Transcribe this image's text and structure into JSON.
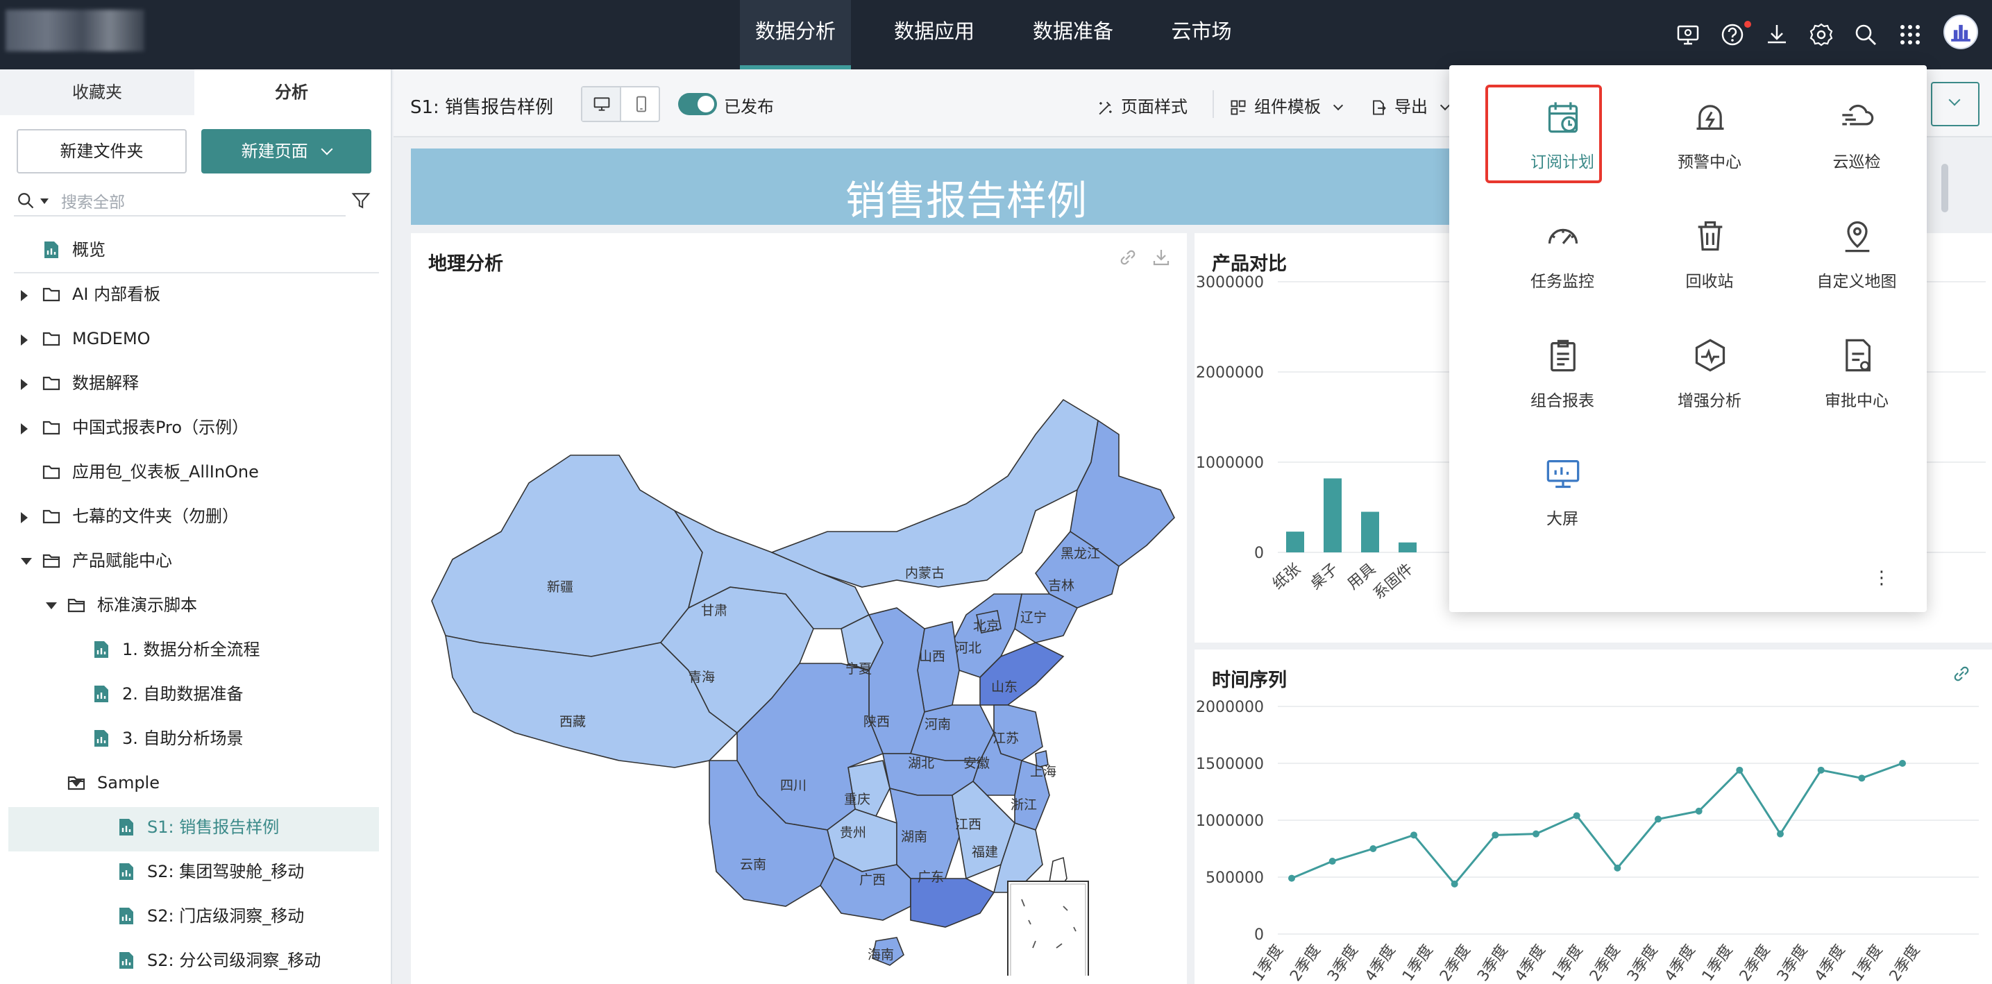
{
  "topnav": {
    "items": [
      {
        "label": "数据分析",
        "active": true
      },
      {
        "label": "数据应用",
        "active": false
      },
      {
        "label": "数据准备",
        "active": false
      },
      {
        "label": "云市场",
        "active": false
      }
    ],
    "icons": [
      "monitor-gear-icon",
      "help-icon",
      "download-icon",
      "settings-icon",
      "search-icon",
      "apps-grid-icon"
    ]
  },
  "sidebar": {
    "tabs": [
      "收藏夹",
      "分析"
    ],
    "active_tab": "分析",
    "new_folder_label": "新建文件夹",
    "new_page_label": "新建页面",
    "search_placeholder": "搜索全部",
    "tree": [
      {
        "label": "概览",
        "type": "page"
      },
      {
        "label": "AI 内部看板",
        "type": "folder"
      },
      {
        "label": "MGDEMO",
        "type": "folder"
      },
      {
        "label": "数据解释",
        "type": "folder"
      },
      {
        "label": "中国式报表Pro（示例）",
        "type": "folder"
      },
      {
        "label": "应用包_仪表板_AllInOne",
        "type": "folder"
      },
      {
        "label": "七幕的文件夹（勿删）",
        "type": "folder"
      },
      {
        "label": "产品赋能中心",
        "type": "folder-open"
      },
      {
        "label": "标准演示脚本",
        "type": "folder-open"
      },
      {
        "label": "1. 数据分析全流程",
        "type": "page"
      },
      {
        "label": "2. 自助数据准备",
        "type": "page"
      },
      {
        "label": "3. 自助分析场景",
        "type": "page"
      },
      {
        "label": "Sample",
        "type": "folder-open"
      },
      {
        "label": "S1:  销售报告样例",
        "type": "page",
        "selected": true
      },
      {
        "label": "S2: 集团驾驶舱_移动",
        "type": "page"
      },
      {
        "label": "S2: 门店级洞察_移动",
        "type": "page"
      },
      {
        "label": "S2: 分公司级洞察_移动",
        "type": "page"
      }
    ]
  },
  "toolbar": {
    "page_name": "S1:  销售报告样例",
    "published_label": "已发布",
    "page_style_label": "页面样式",
    "component_template_label": "组件模板",
    "export_label": "导出"
  },
  "banner_title": "销售报告样例",
  "map_card": {
    "title": "地理分析",
    "regions": {
      "xinjiang": "新疆",
      "xizang": "西藏",
      "qinghai": "青海",
      "gansu": "甘肃",
      "neimenggu": "内蒙古",
      "heilongjiang": "黑龙江",
      "jilin": "吉林",
      "liaoning": "辽宁",
      "beijing": "北京",
      "hebei": "河北",
      "shanxi": "山西",
      "ningxia": "宁夏",
      "shandong": "山东",
      "shaanxi": "陕西",
      "henan": "河南",
      "jiangsu": "江苏",
      "anhui": "安徽",
      "shanghai": "上海",
      "hubei": "湖北",
      "sichuan": "四川",
      "chongqing": "重庆",
      "zhejiang": "浙江",
      "jiangxi": "江西",
      "hunan": "湖南",
      "guizhou": "贵州",
      "yunnan": "云南",
      "fujian": "福建",
      "guangxi": "广西",
      "guangdong": "广东",
      "hainan": "海南"
    }
  },
  "product_card": {
    "title": "产品对比"
  },
  "time_card": {
    "title": "时间序列"
  },
  "chart_data": [
    {
      "type": "bar",
      "title": "产品对比",
      "categories": [
        "纸张",
        "桌子",
        "用具",
        "系固件"
      ],
      "values": [
        230000,
        820000,
        450000,
        110000
      ],
      "ylim": [
        0,
        3000000
      ],
      "yticks": [
        0,
        1000000,
        2000000,
        3000000
      ],
      "color": "#3f9c9c"
    },
    {
      "type": "line",
      "title": "时间序列",
      "x": [
        "1季度",
        "2季度",
        "3季度",
        "4季度",
        "1季度",
        "2季度",
        "3季度",
        "4季度",
        "1季度",
        "2季度",
        "3季度",
        "4季度",
        "1季度",
        "2季度",
        "3季度",
        "4季度",
        "1季度",
        "2季度"
      ],
      "values": [
        490000,
        640000,
        750000,
        870000,
        440000,
        870000,
        880000,
        1040000,
        580000,
        1010000,
        1080000,
        1440000,
        880000,
        1440000,
        1370000,
        1500000
      ],
      "ylim": [
        0,
        2000000
      ],
      "yticks": [
        0,
        500000,
        1000000,
        1500000,
        2000000
      ],
      "color": "#3f9c9c",
      "grid": true
    }
  ],
  "popup": {
    "items": [
      {
        "label": "订阅计划",
        "icon": "calendar-clock-icon",
        "highlight": true
      },
      {
        "label": "预警中心",
        "icon": "alarm-bell-icon"
      },
      {
        "label": "云巡检",
        "icon": "cloud-wind-icon"
      },
      {
        "label": "任务监控",
        "icon": "gauge-icon"
      },
      {
        "label": "回收站",
        "icon": "trash-icon"
      },
      {
        "label": "自定义地图",
        "icon": "map-pin-icon"
      },
      {
        "label": "组合报表",
        "icon": "clipboard-report-icon"
      },
      {
        "label": "增强分析",
        "icon": "hexagon-pulse-icon"
      },
      {
        "label": "审批中心",
        "icon": "approval-doc-icon"
      },
      {
        "label": "大屏",
        "icon": "big-screen-icon"
      }
    ],
    "more_label": "⋮"
  },
  "colors": {
    "accent": "#3b8a89",
    "topbar": "#1f2733",
    "highlight": "#e8372e",
    "map_light": "#a9c7f1",
    "map_mid": "#87a8e8",
    "map_dark": "#5f7fd9"
  }
}
